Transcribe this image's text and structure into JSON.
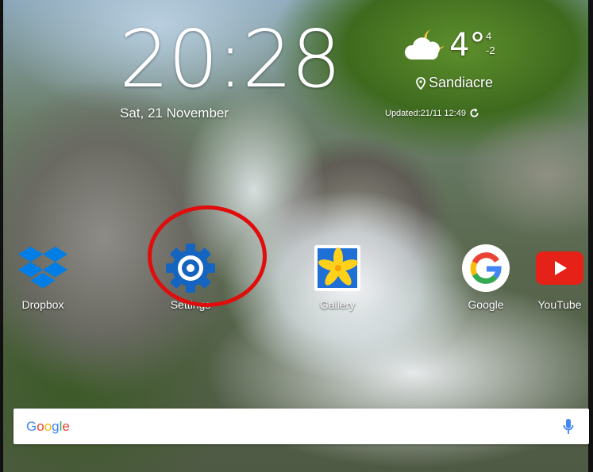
{
  "lockscreen": {
    "time": "20:28",
    "date": "Sat, 21 November"
  },
  "weather": {
    "icon": "cloudy-moon-icon",
    "temperature": "4°",
    "high": "4",
    "low": "-2",
    "location": "Sandiacre",
    "updated": "Updated:21/11 12:49"
  },
  "apps": [
    {
      "label": "Dropbox",
      "icon": "dropbox-icon"
    },
    {
      "label": "Settings",
      "icon": "settings-gear-icon"
    },
    {
      "label": "Gallery",
      "icon": "gallery-icon"
    },
    {
      "label": "Google",
      "icon": "google-icon"
    },
    {
      "label": "YouTube",
      "icon": "youtube-icon"
    }
  ],
  "search": {
    "logo_letters": [
      "G",
      "o",
      "o",
      "g",
      "l",
      "e"
    ],
    "placeholder": "",
    "mic_icon": "microphone-icon"
  },
  "colors": {
    "annotation": "#e00d0d",
    "google_blue": "#4285F4",
    "google_red": "#EA4335",
    "google_yellow": "#FBBC05",
    "google_green": "#34A853",
    "youtube_red": "#E62117",
    "dropbox_blue": "#007EE5",
    "settings_blue": "#1565C0"
  }
}
